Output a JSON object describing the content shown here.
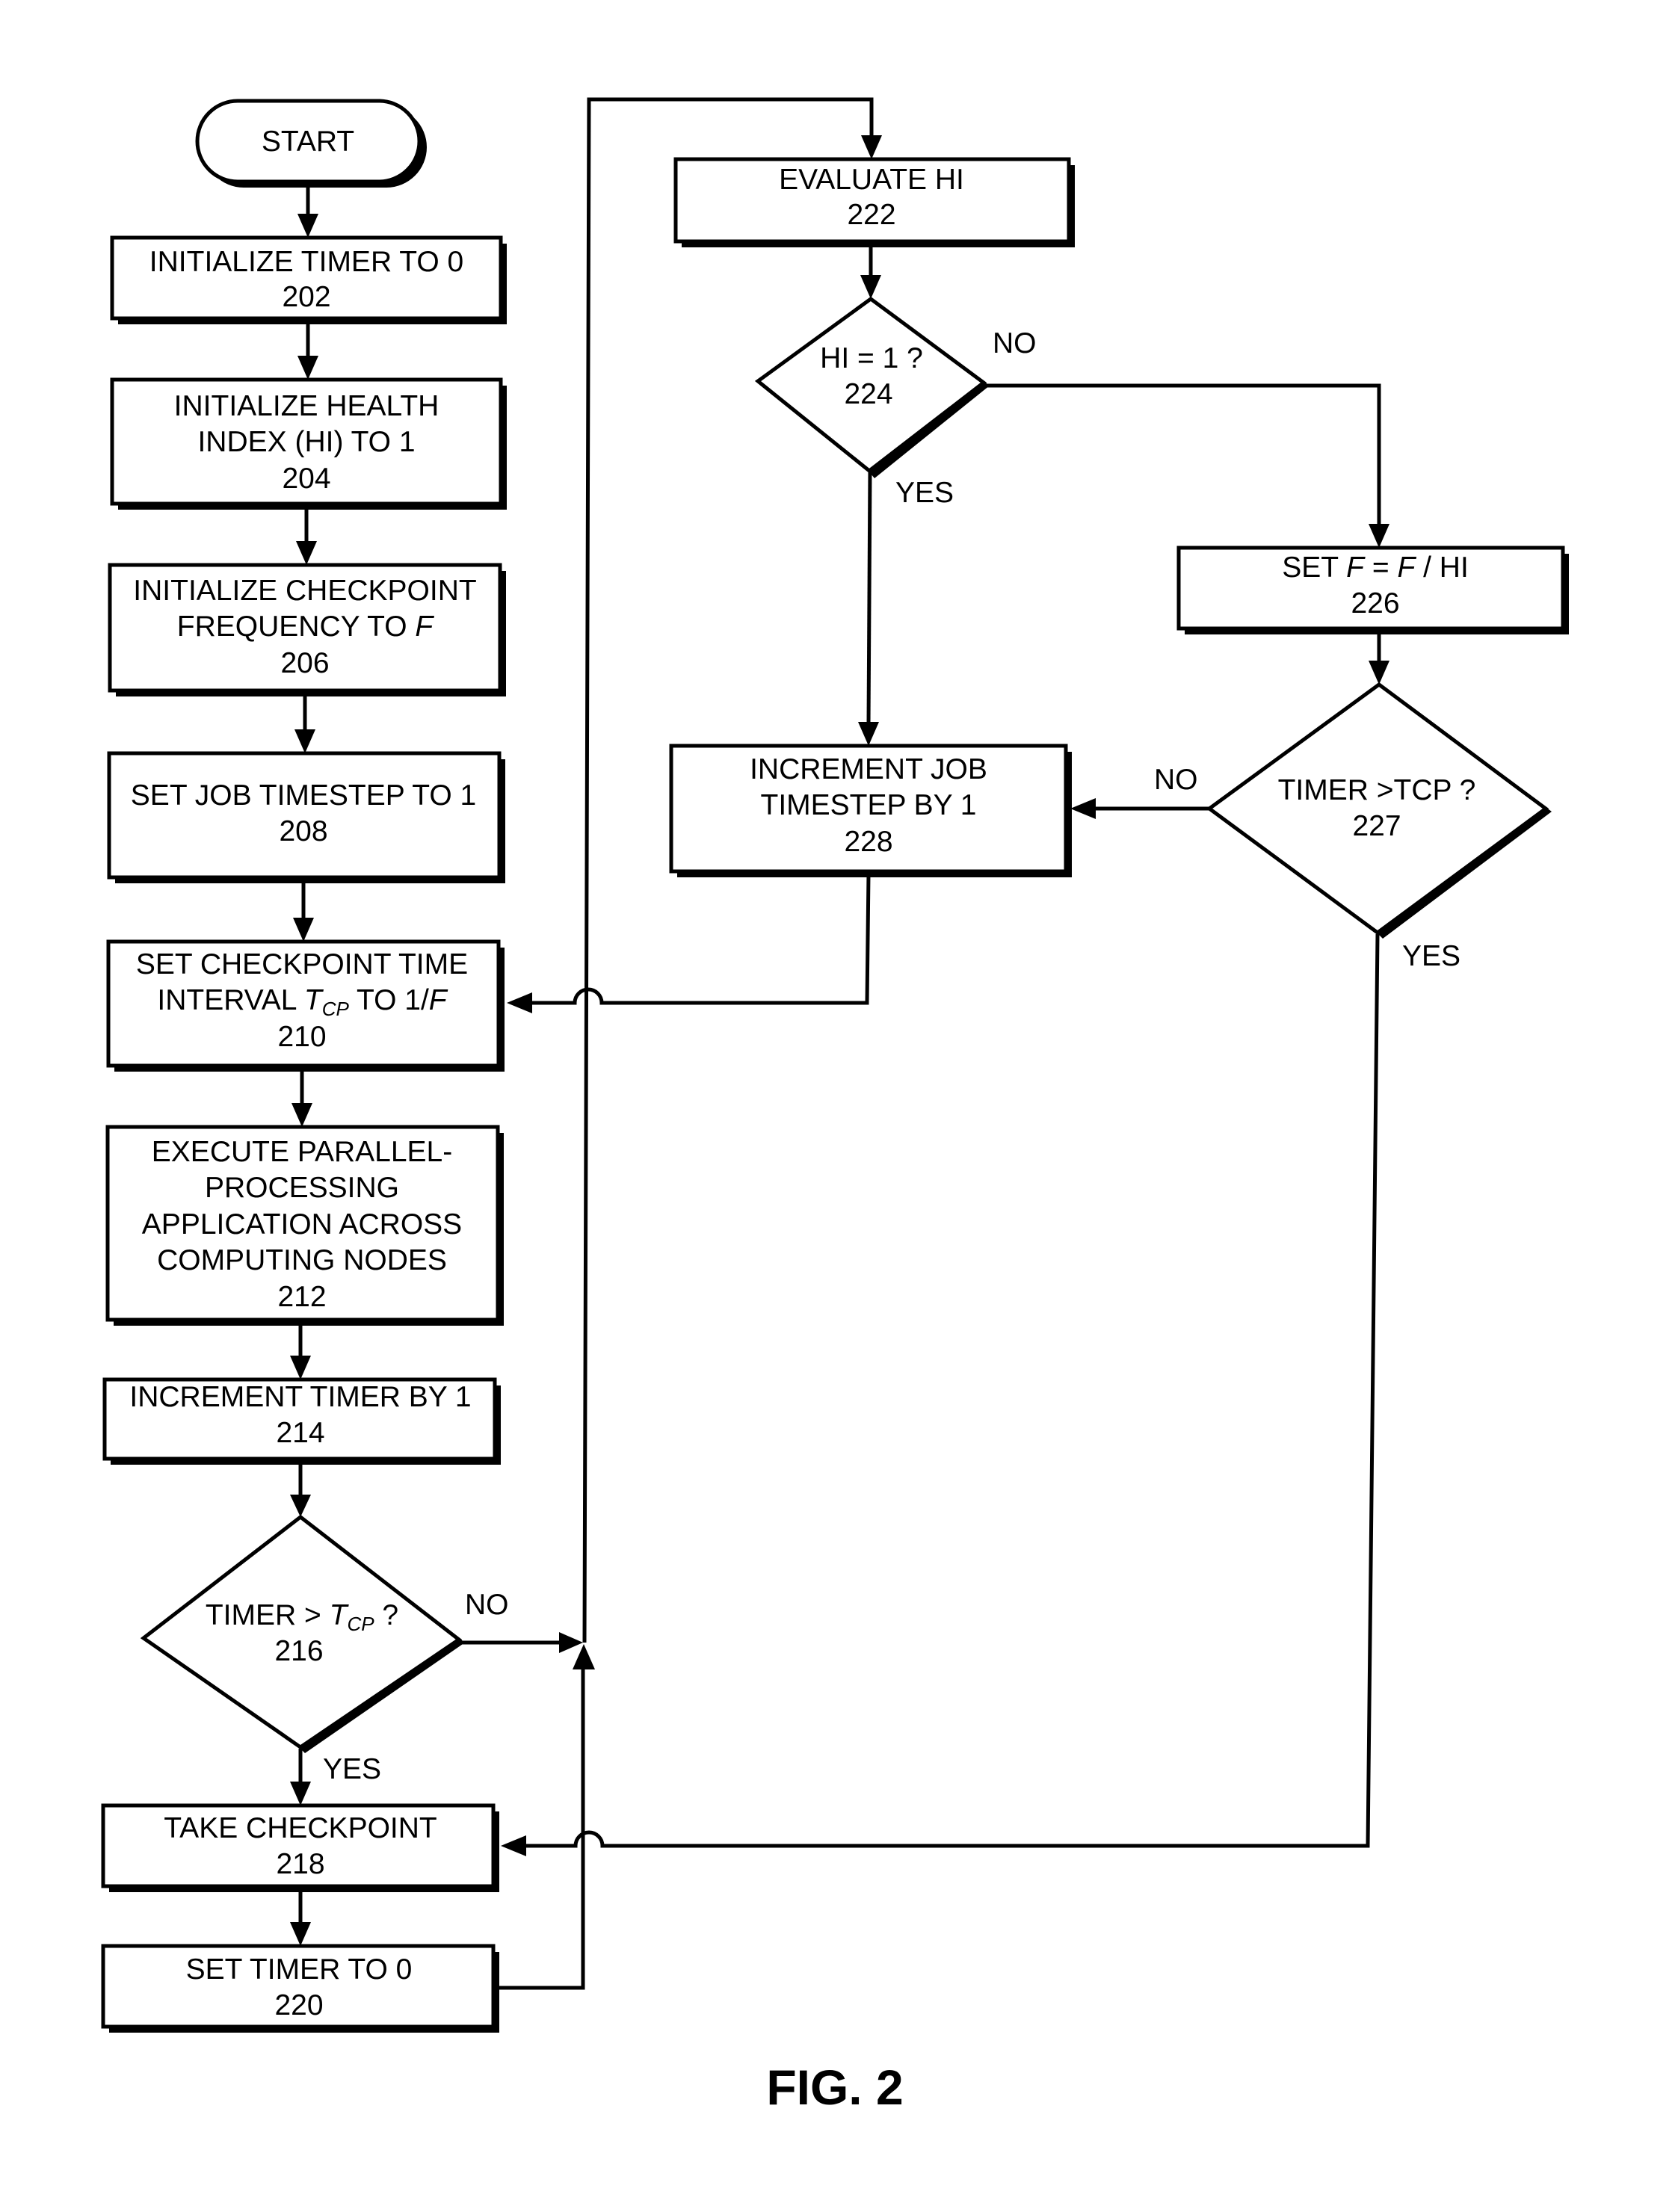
{
  "figure": {
    "caption": "FIG. 2"
  },
  "nodes": {
    "start": {
      "lines": [
        "START"
      ]
    },
    "n202": {
      "lines": [
        "INITIALIZE TIMER TO 0",
        "202"
      ]
    },
    "n204": {
      "lines": [
        "INITIALIZE HEALTH",
        "INDEX (HI) TO 1",
        "204"
      ]
    },
    "n206": {
      "lines": [
        "INITIALIZE CHECKPOINT",
        "FREQUENCY TO F",
        "206"
      ]
    },
    "n208": {
      "lines": [
        "SET JOB TIMESTEP TO 1",
        "208"
      ]
    },
    "n210": {
      "lines": [
        "SET CHECKPOINT TIME",
        "INTERVAL T_CP TO 1/F",
        "210"
      ]
    },
    "n212": {
      "lines": [
        "EXECUTE PARALLEL-",
        "PROCESSING",
        "APPLICATION ACROSS",
        "COMPUTING NODES",
        "212"
      ]
    },
    "n214": {
      "lines": [
        "INCREMENT TIMER BY 1",
        "214"
      ]
    },
    "n216": {
      "lines": [
        "TIMER > T_CP ?",
        "216"
      ]
    },
    "n218": {
      "lines": [
        "TAKE CHECKPOINT",
        "218"
      ]
    },
    "n220": {
      "lines": [
        "SET TIMER TO 0",
        "220"
      ]
    },
    "n222": {
      "lines": [
        "EVALUATE HI",
        "222"
      ]
    },
    "n224": {
      "lines": [
        "HI = 1 ?",
        "224"
      ]
    },
    "n226": {
      "lines": [
        "SET F = F / HI",
        "226"
      ]
    },
    "n227": {
      "lines": [
        "TIMER >TCP ?",
        "227"
      ]
    },
    "n228": {
      "lines": [
        "INCREMENT JOB",
        "TIMESTEP BY 1",
        "228"
      ]
    }
  },
  "edge_labels": {
    "n216_no": "NO",
    "n216_yes": "YES",
    "n224_no": "NO",
    "n224_yes": "YES",
    "n227_no": "NO",
    "n227_yes": "YES"
  },
  "rich": {
    "n206_line2_pre": "FREQUENCY TO ",
    "n206_line2_var": "F",
    "n210_line2_pre": "INTERVAL ",
    "n210_line2_var": "T",
    "n210_line2_sub": "CP",
    "n210_line2_mid": " TO 1/",
    "n210_line2_var2": "F",
    "n216_line1_pre": "TIMER > ",
    "n216_line1_var": "T",
    "n216_line1_sub": "CP",
    "n216_line1_post": " ?",
    "n226_line1_pre": "SET ",
    "n226_line1_var": "F",
    "n226_line1_mid": " = ",
    "n226_line1_var2": "F",
    "n226_line1_post": " / HI"
  }
}
